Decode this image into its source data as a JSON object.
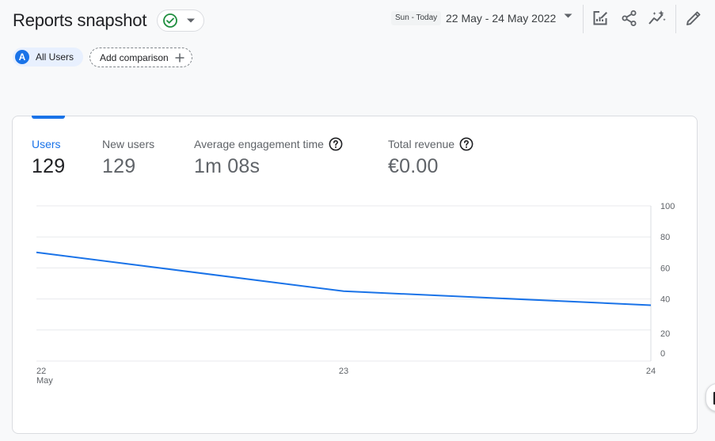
{
  "header": {
    "title": "Reports snapshot",
    "date_comparison_label": "Sun - Today",
    "date_range": "22 May - 24 May 2022"
  },
  "toolbar": {
    "icons": [
      "customize-report-icon",
      "share-icon",
      "insights-icon",
      "edit-icon"
    ]
  },
  "comparison": {
    "segment_letter": "A",
    "segment_label": "All Users",
    "add_label": "Add comparison"
  },
  "metrics": [
    {
      "label": "Users",
      "value": "129",
      "active": true,
      "help": false
    },
    {
      "label": "New users",
      "value": "129",
      "active": false,
      "help": false
    },
    {
      "label": "Average engagement time",
      "value": "1m 08s",
      "active": false,
      "help": true
    },
    {
      "label": "Total revenue",
      "value": "€0.00",
      "active": false,
      "help": true
    }
  ],
  "colors": {
    "accent": "#1a73e8",
    "success": "#1e8e3e",
    "gridline": "#e8eaed",
    "axis_text": "#5f6368"
  },
  "chart_data": {
    "type": "line",
    "x": [
      "22 May",
      "23",
      "24"
    ],
    "x_tick_lines": [
      [
        "22",
        "May"
      ],
      [
        "23"
      ],
      [
        "24"
      ]
    ],
    "series": [
      {
        "values": [
          70,
          45,
          36
        ]
      }
    ],
    "y_ticks": [
      "100",
      "80",
      "60",
      "40",
      "20",
      "0"
    ],
    "ylim": [
      0,
      100
    ],
    "grid": true,
    "y_axis_side": "right"
  }
}
